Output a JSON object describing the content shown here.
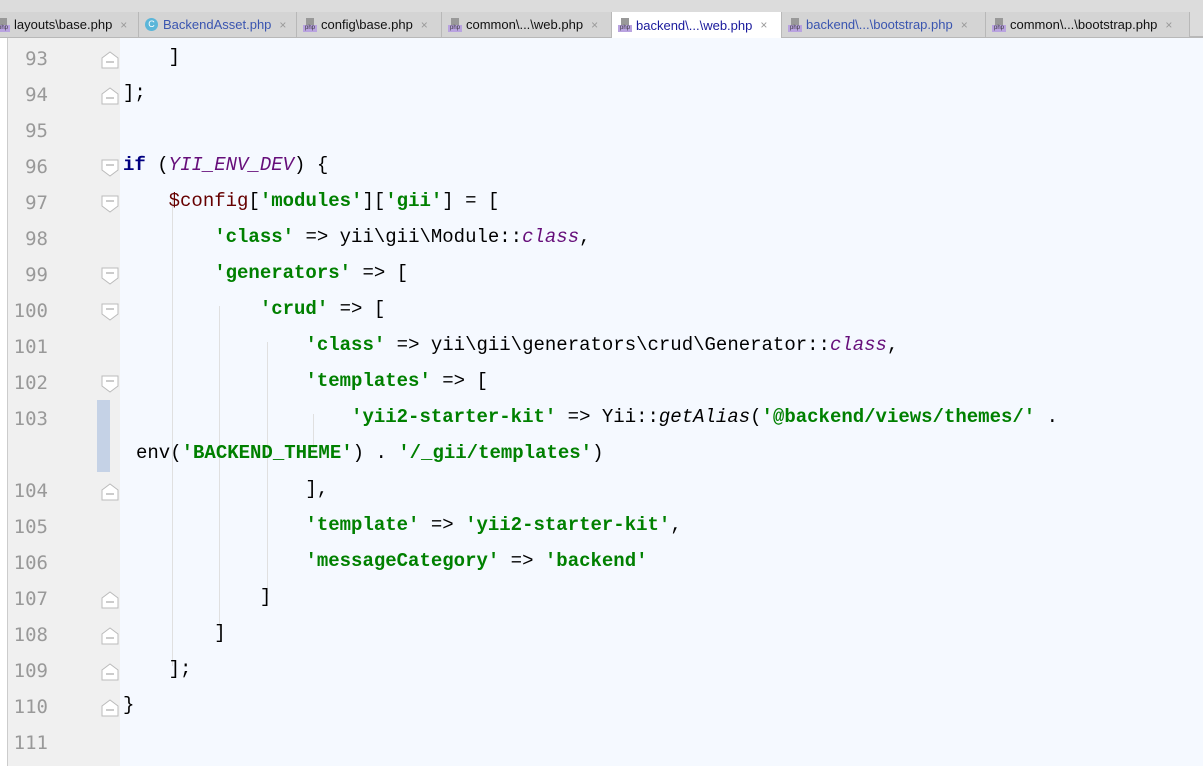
{
  "tabs": [
    {
      "label": "layouts\\base.php",
      "icon": "php-file-icon",
      "color": "#111111"
    },
    {
      "label": "BackendAsset.php",
      "icon": "class-icon",
      "color": "#3a55b0"
    },
    {
      "label": "config\\base.php",
      "icon": "php-file-icon",
      "color": "#111111"
    },
    {
      "label": "common\\...\\web.php",
      "icon": "php-file-icon",
      "color": "#111111"
    },
    {
      "label": "backend\\...\\web.php",
      "icon": "php-file-icon",
      "color": "#1a1a9c",
      "active": true
    },
    {
      "label": "backend\\...\\bootstrap.php",
      "icon": "php-file-icon",
      "color": "#3a55b0"
    },
    {
      "label": "common\\...\\bootstrap.php",
      "icon": "php-file-icon",
      "color": "#111111"
    }
  ],
  "close_glyph": "×",
  "lines": [
    {
      "n": "93",
      "fold": "end",
      "t": [
        [
          "    ]",
          ""
        ]
      ]
    },
    {
      "n": "94",
      "fold": "end",
      "t": [
        [
          "];",
          ""
        ]
      ]
    },
    {
      "n": "95",
      "t": []
    },
    {
      "n": "96",
      "fold": "start",
      "t": [
        [
          "if",
          "kw"
        ],
        [
          " (",
          ""
        ],
        [
          "YII_ENV_DEV",
          "const"
        ],
        [
          ") {",
          ""
        ]
      ]
    },
    {
      "n": "97",
      "fold": "start",
      "t": [
        [
          "    ",
          ""
        ],
        [
          "$config",
          "var"
        ],
        [
          "[",
          ""
        ],
        [
          "'modules'",
          "str"
        ],
        [
          "][",
          ""
        ],
        [
          "'gii'",
          "str"
        ],
        [
          "] = [",
          ""
        ]
      ]
    },
    {
      "n": "98",
      "t": [
        [
          "        ",
          ""
        ],
        [
          "'class'",
          "str"
        ],
        [
          " => yii\\gii\\Module::",
          ""
        ],
        [
          "class",
          "const"
        ],
        [
          ",",
          ""
        ]
      ]
    },
    {
      "n": "99",
      "fold": "start",
      "t": [
        [
          "        ",
          ""
        ],
        [
          "'generators'",
          "str"
        ],
        [
          " => [",
          ""
        ]
      ]
    },
    {
      "n": "100",
      "fold": "start",
      "t": [
        [
          "            ",
          ""
        ],
        [
          "'crud'",
          "str"
        ],
        [
          " => [",
          ""
        ]
      ]
    },
    {
      "n": "101",
      "t": [
        [
          "                ",
          ""
        ],
        [
          "'class'",
          "str"
        ],
        [
          " => yii\\gii\\generators\\crud\\Generator::",
          ""
        ],
        [
          "class",
          "const"
        ],
        [
          ",",
          ""
        ]
      ]
    },
    {
      "n": "102",
      "fold": "start",
      "t": [
        [
          "                ",
          ""
        ],
        [
          "'templates'",
          "str"
        ],
        [
          " => [",
          ""
        ]
      ]
    },
    {
      "n": "103",
      "t": [
        [
          "                    ",
          ""
        ],
        [
          "'yii2-starter-kit'",
          "str"
        ],
        [
          " => Yii::",
          ""
        ],
        [
          "getAlias",
          "fn"
        ],
        [
          "(",
          ""
        ],
        [
          "'@backend/views/themes/'",
          "str"
        ],
        [
          " .",
          ""
        ]
      ]
    },
    {
      "n": "",
      "wrap": true,
      "t": [
        [
          "env(",
          ""
        ],
        [
          "'BACKEND_THEME'",
          "str"
        ],
        [
          ") . ",
          ""
        ],
        [
          "'/_gii/templates'",
          "str"
        ],
        [
          ")",
          ""
        ]
      ]
    },
    {
      "n": "104",
      "fold": "end",
      "t": [
        [
          "                ],",
          ""
        ]
      ]
    },
    {
      "n": "105",
      "t": [
        [
          "                ",
          ""
        ],
        [
          "'template'",
          "str"
        ],
        [
          " => ",
          ""
        ],
        [
          "'yii2-starter-kit'",
          "str"
        ],
        [
          ",",
          ""
        ]
      ]
    },
    {
      "n": "106",
      "t": [
        [
          "                ",
          ""
        ],
        [
          "'messageCategory'",
          "str"
        ],
        [
          " => ",
          ""
        ],
        [
          "'backend'",
          "str"
        ]
      ]
    },
    {
      "n": "107",
      "fold": "end",
      "t": [
        [
          "            ]",
          ""
        ]
      ]
    },
    {
      "n": "108",
      "fold": "end",
      "t": [
        [
          "        ]",
          ""
        ]
      ]
    },
    {
      "n": "109",
      "fold": "end",
      "t": [
        [
          "    ];",
          ""
        ]
      ]
    },
    {
      "n": "110",
      "fold": "end",
      "t": [
        [
          "}",
          ""
        ]
      ]
    },
    {
      "n": "111",
      "t": []
    }
  ]
}
